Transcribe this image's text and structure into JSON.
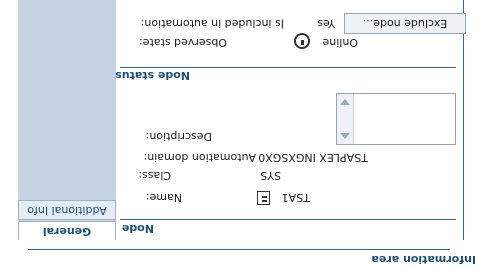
{
  "window": {
    "title": "Information area"
  },
  "tabs": [
    {
      "label": "General",
      "active": true
    },
    {
      "label": "Additional Info",
      "active": false
    }
  ],
  "node_section": {
    "title": "Node",
    "fields": {
      "name": {
        "label": "Name:",
        "value": "TSA1"
      },
      "class": {
        "label": "Class:",
        "value": "SYS"
      },
      "automation_domain": {
        "label": "Automation domain:",
        "value": "TSAPLEX INGXSGX0"
      },
      "description": {
        "label": "Description:",
        "value": ""
      }
    }
  },
  "node_status_section": {
    "title": "Node status",
    "observed_state": {
      "label": "Observed state:",
      "value": "Online"
    },
    "automation": {
      "label": "Is included in automation:",
      "value": "Yes",
      "button_label": "Exclude node..."
    }
  },
  "colors": {
    "accent": "#2a6aa6",
    "tab_bar": "#c5d3e2"
  },
  "icons": {
    "node": "server-node-icon",
    "status": "online-status-icon"
  }
}
